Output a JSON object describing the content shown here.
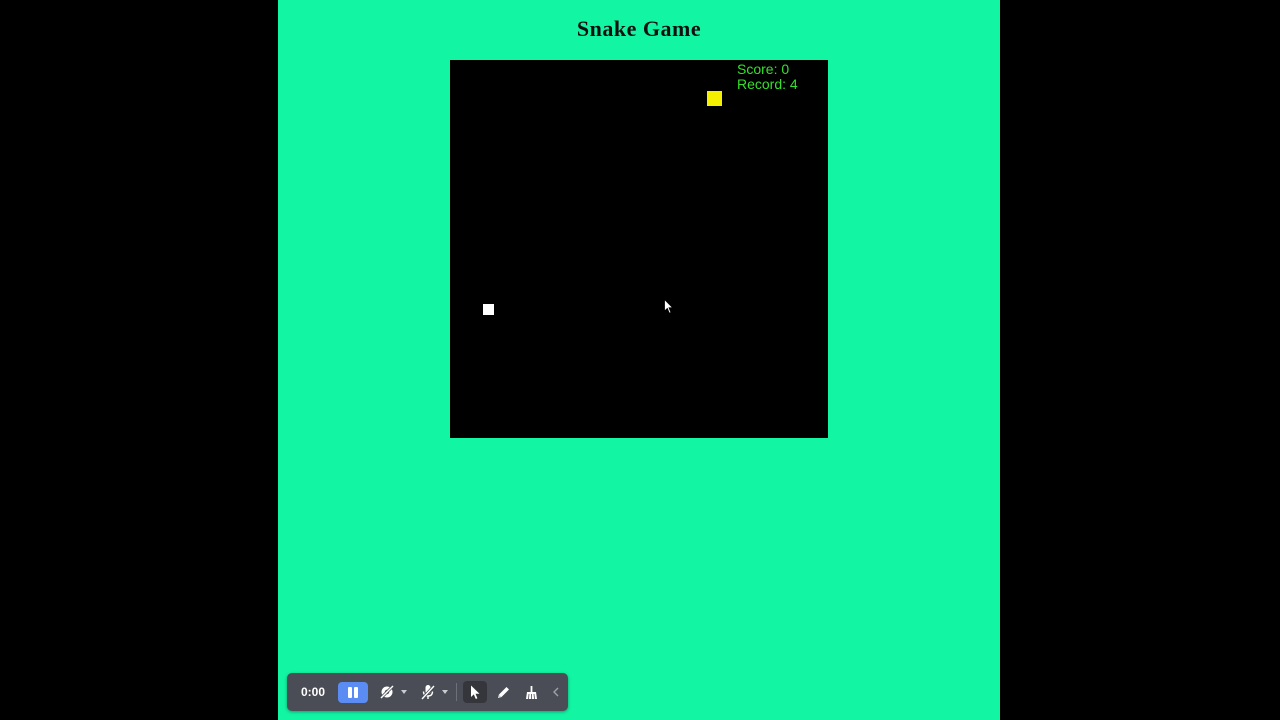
{
  "game": {
    "title": "Snake Game",
    "score_text": "Score: 0",
    "record_text": "Record: 4",
    "score": 0,
    "record": 4
  },
  "colors": {
    "page_background": "#12f5a3",
    "board_background": "#000000",
    "hud_text": "#36e02c",
    "food": "#f5f000",
    "snake": "#ffffff",
    "toolbar": "#4a4d55",
    "pause_button": "#5b8cf4"
  },
  "recorder_toolbar": {
    "timer": "0:00",
    "icons": [
      "pause-icon",
      "camera-off-icon",
      "microphone-off-icon",
      "pointer-icon",
      "pen-icon",
      "broom-icon",
      "chevron-left-icon"
    ]
  }
}
